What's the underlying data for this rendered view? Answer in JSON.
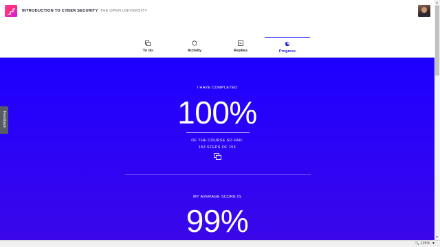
{
  "header": {
    "course_title": "INTRODUCTION TO CYBER SECURITY",
    "organization": "THE OPEN UNIVERSITY",
    "logo_icon": "stairs-logo-icon",
    "avatar_icon": "user-avatar"
  },
  "tabs": [
    {
      "label": "To do",
      "icon": "copy-icon",
      "active": false
    },
    {
      "label": "Activity",
      "icon": "circle-icon",
      "active": false
    },
    {
      "label": "Replies",
      "icon": "reply-icon",
      "active": false
    },
    {
      "label": "Progress",
      "icon": "progress-icon",
      "active": true
    }
  ],
  "progress": {
    "completed_label": "I HAVE COMPLETED",
    "completed_percent": "100%",
    "course_so_far_label": "OF THE COURSE SO FAR:",
    "steps_text": "153 STEPS OF 153",
    "steps_icon": "steps-stack-icon",
    "average_label": "MY AVERAGE SCORE IS",
    "average_percent": "99%"
  },
  "feedback_tab": {
    "label": "Feedback"
  },
  "statusbar": {
    "zoom": "125%"
  },
  "colors": {
    "hero_top": "#1d00ff",
    "hero_bottom": "#3a07e8",
    "active_tab": "#4d4dff",
    "logo_gradient_start": "#ff3fa0",
    "logo_gradient_end": "#c21dff"
  }
}
